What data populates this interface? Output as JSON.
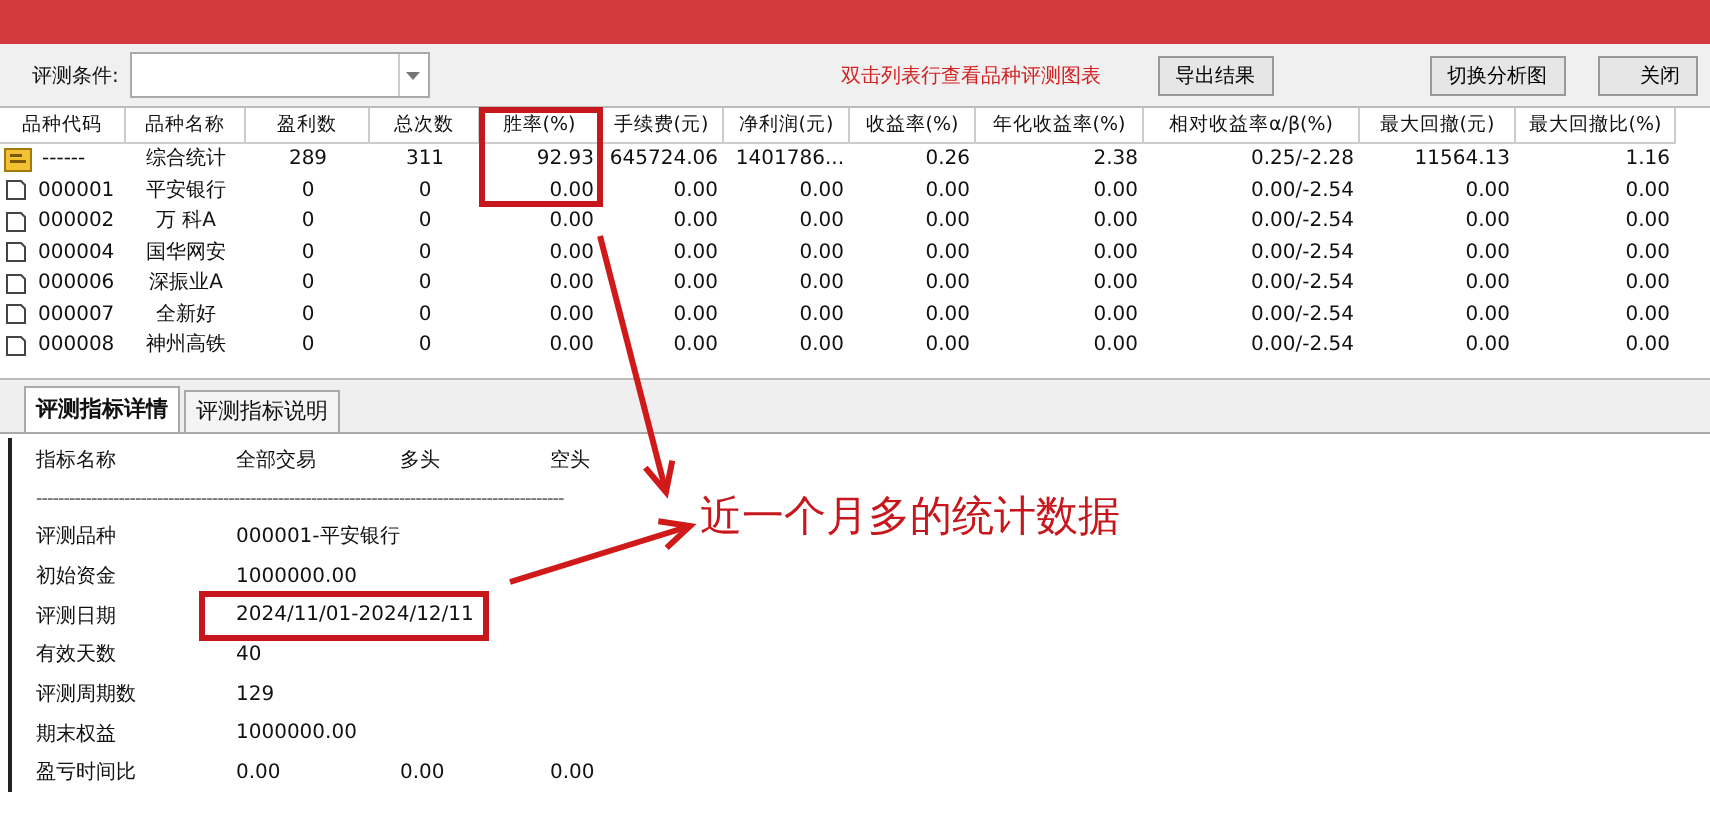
{
  "toolbar": {
    "condition_label": "评测条件:",
    "hint": "双击列表行查看品种评测图表",
    "buttons": [
      "导出结果",
      "切换分析图",
      "关闭"
    ]
  },
  "table": {
    "columns": [
      "品种代码",
      "品种名称",
      "盈利数",
      "总次数",
      "胜率(%)",
      "手续费(元)",
      "净利润(元)",
      "收益率(%)",
      "年化收益率(%)",
      "相对收益率α/β(%)",
      "最大回撤(元)",
      "最大回撤比(%)"
    ],
    "rows": [
      {
        "kind": "summary",
        "cells": [
          "------",
          "综合统计",
          "289",
          "311",
          "92.93",
          "645724.06",
          "1401786...",
          "0.26",
          "2.38",
          "0.25/-2.28",
          "11564.13",
          "1.16"
        ]
      },
      {
        "kind": "stock",
        "cells": [
          "000001",
          "平安银行",
          "0",
          "0",
          "0.00",
          "0.00",
          "0.00",
          "0.00",
          "0.00",
          "0.00/-2.54",
          "0.00",
          "0.00"
        ]
      },
      {
        "kind": "stock",
        "cells": [
          "000002",
          "万 科A",
          "0",
          "0",
          "0.00",
          "0.00",
          "0.00",
          "0.00",
          "0.00",
          "0.00/-2.54",
          "0.00",
          "0.00"
        ]
      },
      {
        "kind": "stock",
        "cells": [
          "000004",
          "国华网安",
          "0",
          "0",
          "0.00",
          "0.00",
          "0.00",
          "0.00",
          "0.00",
          "0.00/-2.54",
          "0.00",
          "0.00"
        ]
      },
      {
        "kind": "stock",
        "cells": [
          "000006",
          "深振业A",
          "0",
          "0",
          "0.00",
          "0.00",
          "0.00",
          "0.00",
          "0.00",
          "0.00/-2.54",
          "0.00",
          "0.00"
        ]
      },
      {
        "kind": "stock",
        "cells": [
          "000007",
          "全新好",
          "0",
          "0",
          "0.00",
          "0.00",
          "0.00",
          "0.00",
          "0.00",
          "0.00/-2.54",
          "0.00",
          "0.00"
        ]
      },
      {
        "kind": "stock",
        "cells": [
          "000008",
          "神州高铁",
          "0",
          "0",
          "0.00",
          "0.00",
          "0.00",
          "0.00",
          "0.00",
          "0.00/-2.54",
          "0.00",
          "0.00"
        ]
      }
    ]
  },
  "tabs": [
    {
      "label": "评测指标详情",
      "selected": true
    },
    {
      "label": "评测指标说明",
      "selected": false
    }
  ],
  "details": {
    "header": [
      "指标名称",
      "全部交易",
      "多头",
      "空头"
    ],
    "separator": "------------------------------------------------------------------------------------------------",
    "rows": [
      {
        "cells": [
          "评测品种",
          "000001-平安银行"
        ]
      },
      {
        "cells": [
          "初始资金",
          "1000000.00"
        ]
      },
      {
        "cells": [
          "评测日期",
          "2024/11/01-2024/12/11"
        ]
      },
      {
        "cells": [
          "有效天数",
          "40"
        ]
      },
      {
        "cells": [
          "评测周期数",
          "129"
        ]
      },
      {
        "cells": [
          "期末权益",
          "1000000.00"
        ]
      },
      {
        "cells": [
          "盈亏时间比",
          "0.00",
          "0.00",
          "0.00"
        ]
      }
    ]
  },
  "annotation": {
    "caption": "近一个月多的统计数据"
  }
}
